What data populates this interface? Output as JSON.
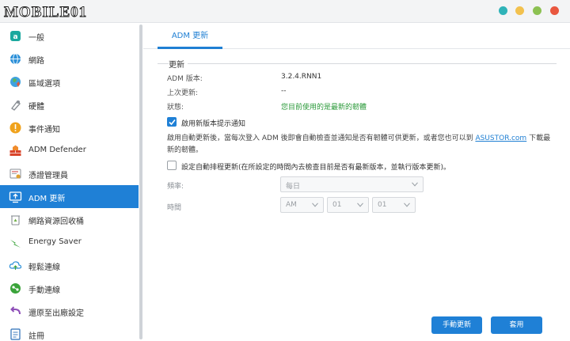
{
  "window": {
    "logo_text": "MOBILE01",
    "controls": [
      {
        "name": "teal",
        "color": "#2fb3b8"
      },
      {
        "name": "yellow",
        "color": "#f2c14e"
      },
      {
        "name": "green",
        "color": "#8cc152"
      },
      {
        "name": "red",
        "color": "#e9573f"
      }
    ]
  },
  "sidebar": {
    "items": [
      {
        "label": "一般",
        "icon": "general-icon",
        "color": "#1aa89e"
      },
      {
        "label": "網路",
        "icon": "globe-icon",
        "color": "#2a8fd8"
      },
      {
        "label": "區域選項",
        "icon": "region-globe-icon",
        "color": "#e05a3a"
      },
      {
        "label": "硬體",
        "icon": "hardware-icon",
        "color": "#8a8f95"
      },
      {
        "label": "事件通知",
        "icon": "alert-icon",
        "color": "#f0a21c"
      },
      {
        "label": "ADM Defender",
        "icon": "firewall-icon",
        "color": "#d9452b"
      },
      {
        "label": "憑證管理員",
        "icon": "certificate-icon",
        "color": "#e0a12e"
      },
      {
        "label": "ADM 更新",
        "icon": "update-icon",
        "color": "#ffffff",
        "active": true
      },
      {
        "label": "網路資源回收桶",
        "icon": "recycle-bin-icon",
        "color": "#6fae46"
      },
      {
        "label": "Energy Saver",
        "icon": "energy-icon",
        "color": "#3aa33a"
      },
      {
        "label": "輕鬆連線",
        "icon": "cloud-connect-icon",
        "color": "#2a8fd8"
      },
      {
        "label": "手動連線",
        "icon": "manual-connect-icon",
        "color": "#3aa33a"
      },
      {
        "label": "還原至出廠設定",
        "icon": "restore-icon",
        "color": "#8e4fb8"
      },
      {
        "label": "註冊",
        "icon": "register-icon",
        "color": "#2a6fb8"
      }
    ]
  },
  "main": {
    "tab_label": "ADM 更新",
    "section_title": "更新",
    "info": [
      {
        "label": "ADM 版本:",
        "value": "3.2.4.RNN1"
      },
      {
        "label": "上次更新:",
        "value": "--"
      },
      {
        "label": "狀態:",
        "value": "您目前使用的是最新的韌體"
      }
    ],
    "enable_notify_label": "啟用新版本提示通知",
    "description_pre": "啟用自動更新後，當每次登入 ADM 後即會自動檢查並通知是否有韌體可供更新，或者您也可以到 ",
    "description_link": "ASUSTOR.com",
    "description_post": " 下載最新的韌體。",
    "schedule_label": "設定自動排程更新(在所設定的時間內去檢查目前是否有最新版本，並執行版本更新)。",
    "frequency_label": "頻率:",
    "frequency_value": "每日",
    "time_label": "時間",
    "time_ampm": "AM",
    "time_hour": "01",
    "time_minute": "01",
    "manual_update_button": "手動更新",
    "apply_button": "套用"
  }
}
